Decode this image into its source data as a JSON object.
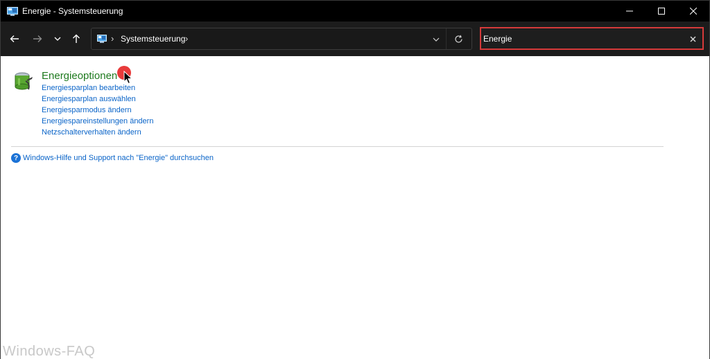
{
  "window": {
    "title": "Energie - Systemsteuerung"
  },
  "caption": {
    "minimize_icon": "minimize-icon",
    "maximize_icon": "maximize-icon",
    "close_icon": "close-icon"
  },
  "navigation": {
    "address_crumb": "Systemsteuerung",
    "search_value": "Energie"
  },
  "results": {
    "title": "Energieoptionen",
    "tasks": [
      "Energiesparplan bearbeiten",
      "Energiesparplan auswählen",
      "Energiesparmodus ändern",
      "Energiespareinstellungen ändern",
      "Netzschalterverhalten ändern"
    ],
    "help_link": "Windows-Hilfe und Support nach \"Energie\" durchsuchen"
  },
  "watermark": "Windows-FAQ",
  "colors": {
    "titlebar": "#000000",
    "navbar": "#1c1c1c",
    "search_highlight": "#d63a3a",
    "result_title": "#1e7a1e",
    "link": "#0a64c8",
    "click_marker": "#e83b3b"
  }
}
